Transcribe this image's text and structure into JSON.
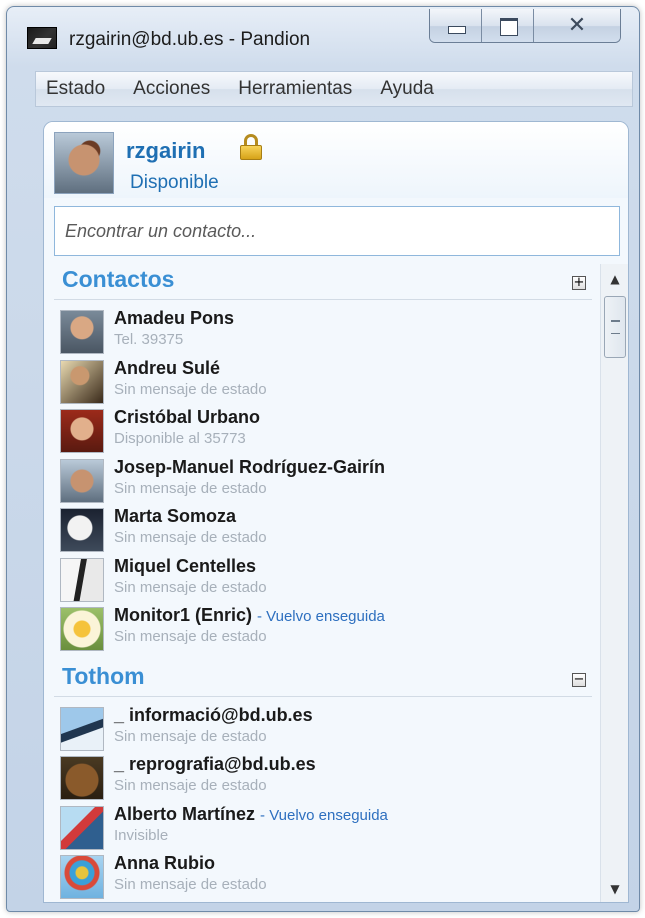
{
  "window": {
    "title": "rzgairin@bd.ub.es - Pandion",
    "close_glyph": "✕"
  },
  "menu": [
    "Estado",
    "Acciones",
    "Herramientas",
    "Ayuda"
  ],
  "profile": {
    "name": "rzgairin",
    "status": "Disponible"
  },
  "search": {
    "placeholder": "Encontrar un contacto..."
  },
  "groups": [
    {
      "title": "Contactos",
      "toggle": "+",
      "contacts": [
        {
          "name": "Amadeu Pons",
          "away": "",
          "message": "Tel. 39375",
          "avatar": "man-portrait"
        },
        {
          "name": "Andreu Sulé",
          "away": "",
          "message": "Sin mensaje de estado",
          "avatar": "dark-portrait"
        },
        {
          "name": "Cristóbal Urbano",
          "away": "",
          "message": "Disponible al 35773",
          "avatar": "red-portrait"
        },
        {
          "name": "Josep-Manuel Rodríguez-Gairín",
          "away": "",
          "message": "Sin mensaje de estado",
          "avatar": "waving-man"
        },
        {
          "name": "Marta Somoza",
          "away": "",
          "message": "Sin mensaje de estado",
          "avatar": "astronaut"
        },
        {
          "name": "Miquel Centelles",
          "away": "",
          "message": "Sin mensaje de estado",
          "avatar": "guitar"
        },
        {
          "name": "Monitor1 (Enric)",
          "away": "- Vuelvo enseguida",
          "message": "Sin mensaje de estado",
          "avatar": "flower"
        }
      ]
    },
    {
      "title": "Tothom",
      "toggle": "−",
      "contacts": [
        {
          "name": "_ informació@bd.ub.es",
          "away": "",
          "message": "Sin mensaje de estado",
          "avatar": "skier"
        },
        {
          "name": "_ reprografia@bd.ub.es",
          "away": "",
          "message": "Sin mensaje de estado",
          "avatar": "bear"
        },
        {
          "name": "Alberto Martínez",
          "away": "- Vuelvo enseguida",
          "message": "Invisible",
          "avatar": "snowboarder"
        },
        {
          "name": "Anna Rubio",
          "away": "",
          "message": "Sin mensaje de estado",
          "avatar": "balloon"
        }
      ]
    }
  ],
  "scrollbar": {
    "up": "▲",
    "down": "▼"
  }
}
